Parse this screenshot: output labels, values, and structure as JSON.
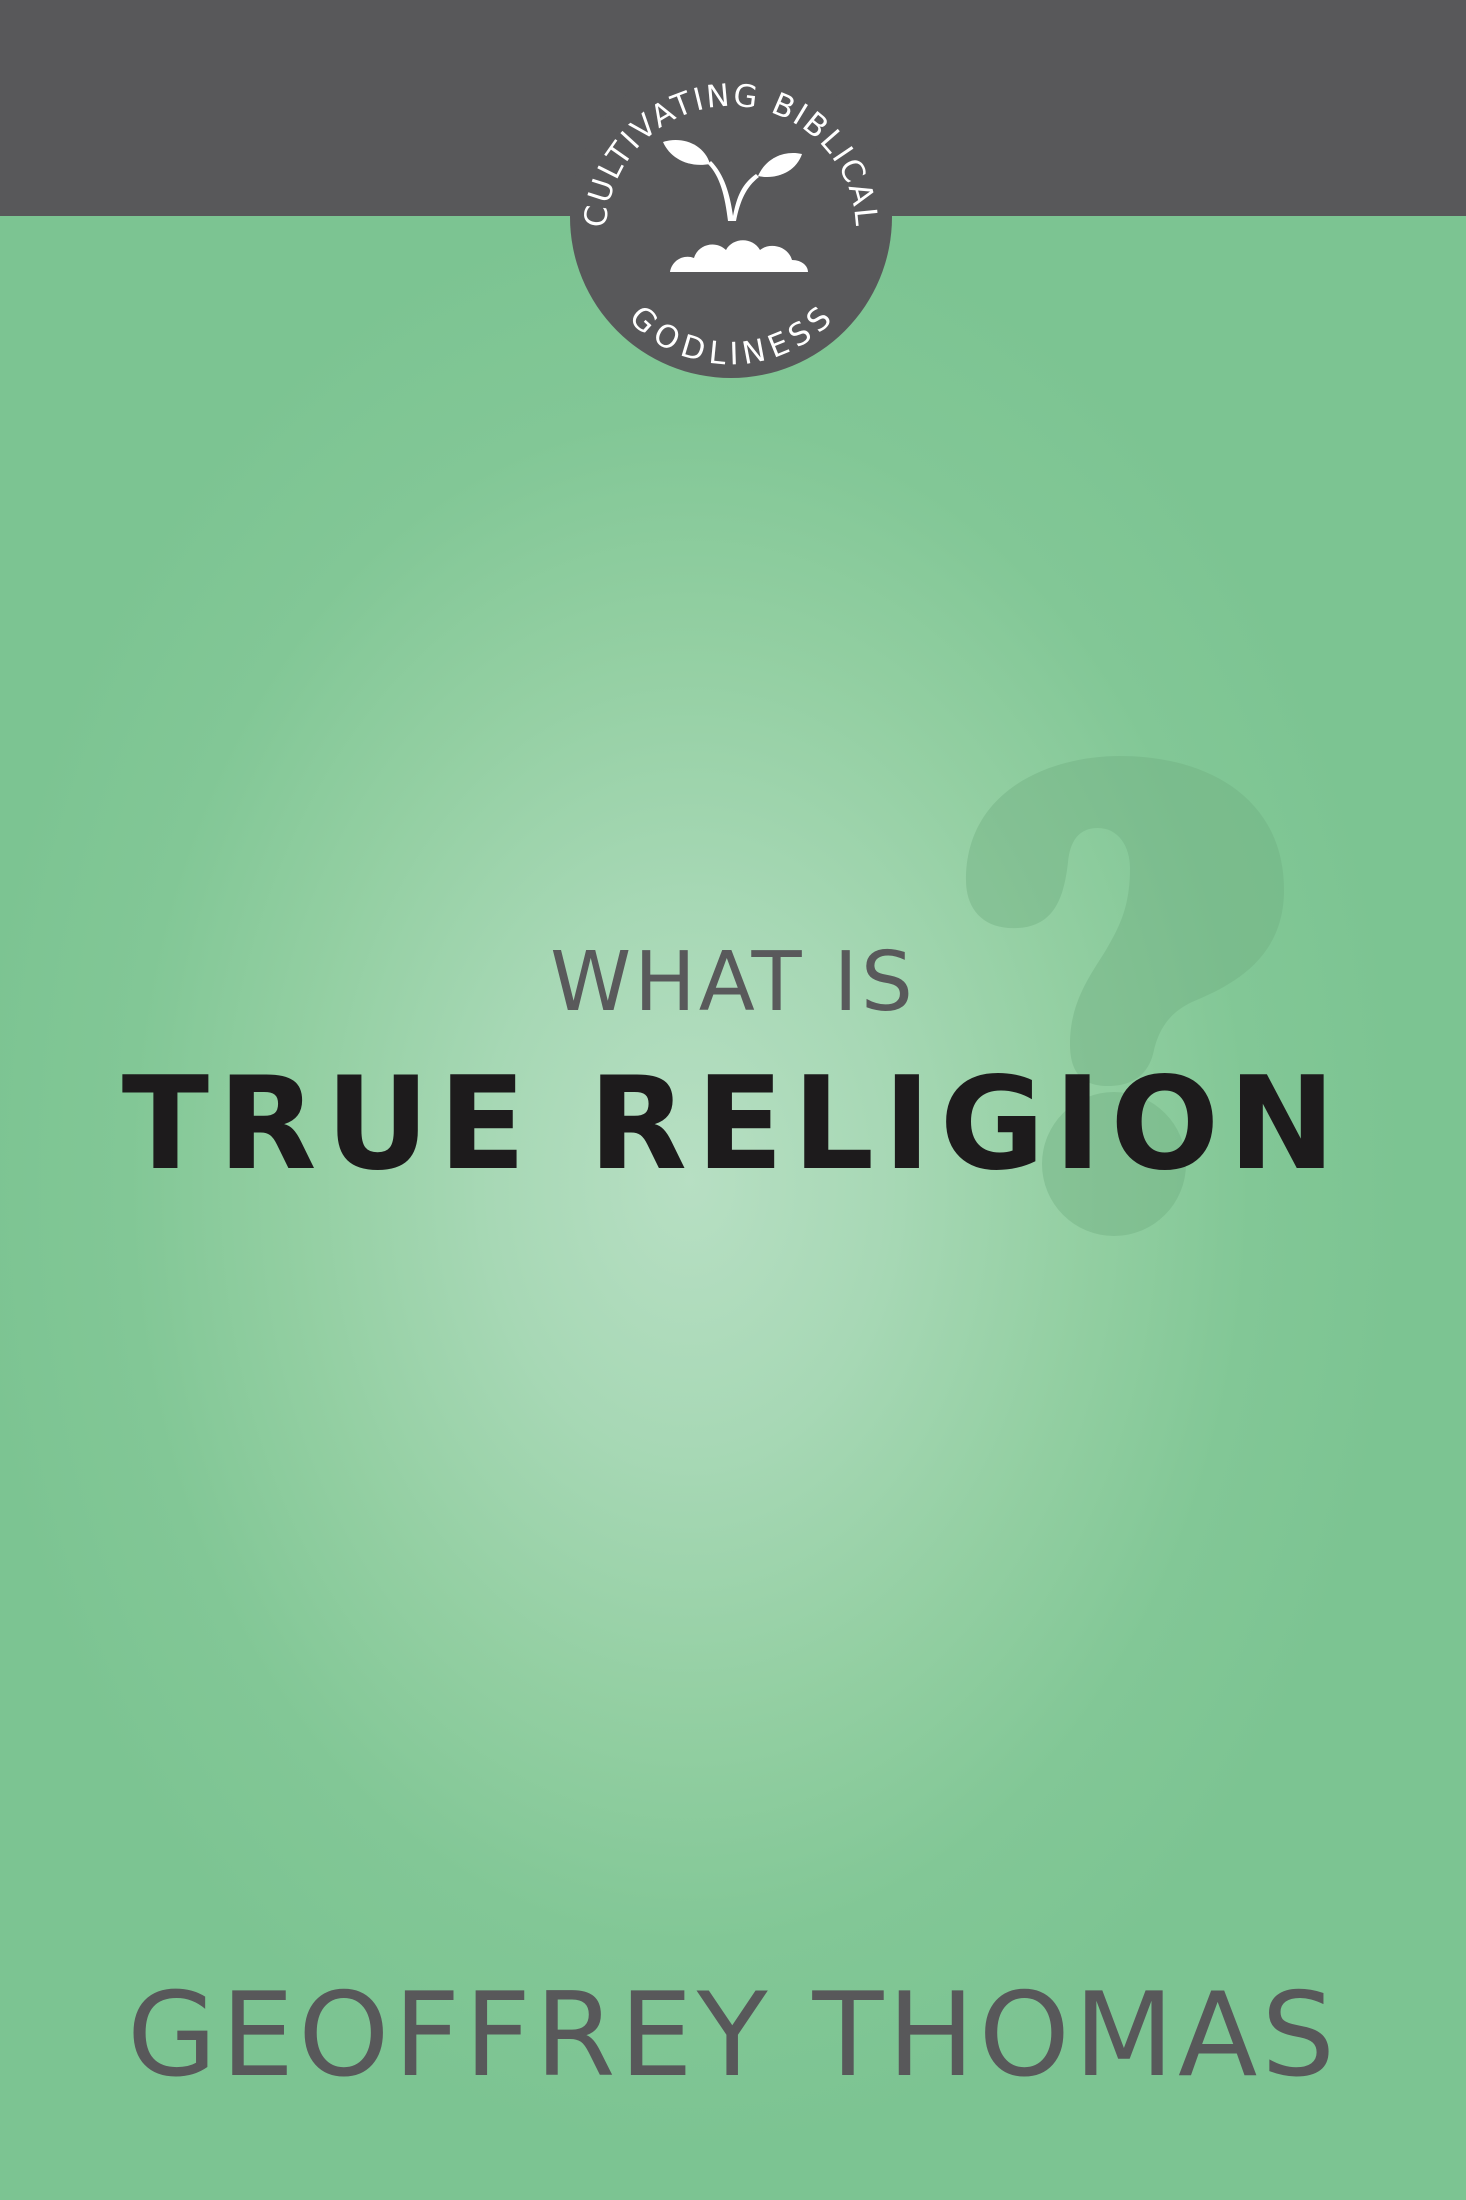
{
  "series_badge": {
    "top_text": "CULTIVATING BIBLICAL",
    "bottom_text": "GODLINESS",
    "icon": "seedling-icon"
  },
  "title": {
    "line1": "WHAT IS",
    "line2": "TRUE RELIGION"
  },
  "decoration": {
    "icon": "question-mark-icon"
  },
  "author": "GEOFFREY THOMAS",
  "colors": {
    "background_green": "#7dc593",
    "band_gray": "#58585a",
    "title_dark": "#1d1b1c",
    "text_gray": "#59595b"
  }
}
